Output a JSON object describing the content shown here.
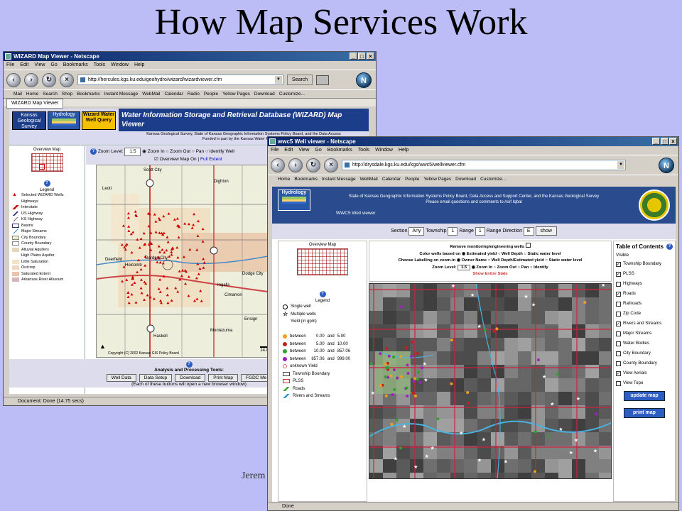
{
  "slide": {
    "title": "How Map Services Work",
    "footer": "Jerem"
  },
  "window1": {
    "title": "WIZARD Map Viewer - Netscape",
    "menu": [
      "File",
      "Edit",
      "View",
      "Go",
      "Bookmarks",
      "Tools",
      "Window",
      "Help"
    ],
    "url": "http://hercules.kgs.ku.edu/geohydro/wizard/wizardviewer.cfm",
    "search_label": "Search",
    "personal": [
      "Mail",
      "Home",
      "Search",
      "Shop",
      "Bookmarks",
      "Instant Message",
      "WebMail",
      "Calendar",
      "Radio",
      "People",
      "Yellow Pages",
      "Download",
      "Customize..."
    ],
    "tab": "WIZARD Map Viewer",
    "logo_kgs": "Kansas Geological Survey",
    "logo_hydro": "Hydrology",
    "logo_wizard": "Wizard Water Well Query",
    "page_title": "Water Information Storage and Retrieval Database (WIZARD) Map Viewer",
    "sub_line1": "Kansas Geological Survey, State of Kansas Geographic Information Systems Policy Board, and the Data Access",
    "sub_line2": "Funded in part by the Kansas Water Plan Fund.",
    "overview_label": "Overview Map",
    "legend_title": "Legend",
    "legend": [
      "Selected WIZARD Wells",
      "Highways",
      "Interstate",
      "US Highway",
      "KS Highway",
      "Basins",
      "Major Streams",
      "City Boundary",
      "County Boundary",
      "Alluvial Aquifers",
      "High Plains Aquifer",
      "Little Saturation",
      "Outcrop",
      "Saturated Extent",
      "Arkansas River Alluvium"
    ],
    "zoom_label": "Zoom Level:",
    "zoom_value": "1.5",
    "zoom_in": "Zoom In",
    "zoom_out": "Zoom Out",
    "pan": "Pan",
    "identify": "Identify Well",
    "overview_on": "Overview Map On",
    "full_extent": "Full Extent",
    "towns": [
      "Scott City",
      "Leoti",
      "Dighton",
      "Ness City",
      "Tribune",
      "Kearny",
      "Deerfield",
      "Holcomb",
      "Garden City",
      "Ingalls",
      "Cimarron",
      "Dodge City",
      "Ensign",
      "Montezuma",
      "Haskell",
      "Ulysses",
      "Sublette"
    ],
    "scale": "14.0 mi",
    "copyright": "Copyright (C) 2002 Kansas GIS Policy Board",
    "tools_title": "Analysis and Processing Tools:",
    "tools": [
      "Well Data",
      "Data Setup",
      "Download",
      "Print Map",
      "FGDC Me"
    ],
    "tools_note": "(Each of these buttons will open a new browser window)",
    "status": "Document: Done (14.75 secs)"
  },
  "window2": {
    "title": "wwc5 Well viewer - Netscape",
    "menu": [
      "File",
      "Edit",
      "View",
      "Go",
      "Bookmarks",
      "Tools",
      "Window",
      "Help"
    ],
    "url": "http://drysdale.kgs.ku.edu/kgs/wwc5/wellviewer.cfm",
    "personal": [
      "Home",
      "Bookmarks",
      "Instant Message",
      "WebMail",
      "Calendar",
      "People",
      "Yellow Pages",
      "Download",
      "Customize..."
    ],
    "logo_hydro": "Hydrology",
    "head_line1": "State of Kansas Geographic Information Systems Policy Board, Data Access and Support Center, and the Kansas Geological Survey",
    "head_line2": "Please email questions and comments to Asif Iqbal",
    "page_title": "WWC5 Well viewer",
    "section_label": "Section",
    "section_value": "Any",
    "township_label": "Township",
    "township_value": "1",
    "range_label": "Range",
    "range_value": "1",
    "range_dir_label": "Range Direction",
    "range_dir_value": "E",
    "show_label": "show",
    "overview_label": "Overview Map",
    "ctrl_remove": "Remove monitoring/engineering wells",
    "ctrl_color": "Color wells based on",
    "ctrl_color_opts": [
      "Estimated yield",
      "Well Depth",
      "Static water level"
    ],
    "ctrl_label": "Choose Labelling on zoom-in",
    "ctrl_label_opts": [
      "Owner Name",
      "Well Depth/Estimated yield",
      "Static water level"
    ],
    "ctrl_zoom": "Zoom Level:",
    "ctrl_zoom_value": "1.5",
    "ctrl_zoom_opts": [
      "Zoom In",
      "Zoom Out",
      "Pan",
      "Identify"
    ],
    "ctrl_show_state": "Show Entire State",
    "legend_title": "Legend",
    "legend": [
      "Single well",
      "Multiple wells",
      "Yield (in gpm)"
    ],
    "yield": [
      {
        "label": "between",
        "a": "0.00",
        "and": "and",
        "b": "5.00",
        "color": "#f0a020"
      },
      {
        "label": "between",
        "a": "5.00",
        "and": "and",
        "b": "10.00",
        "color": "#c02020"
      },
      {
        "label": "between",
        "a": "10.00",
        "and": "and",
        "b": "857.06",
        "color": "#30a030"
      },
      {
        "label": "between",
        "a": "857.06",
        "and": "and",
        "b": "999.00",
        "color": "#a020c0"
      }
    ],
    "unknown": "unknown Yield",
    "legend_layers": [
      "Township Boundary",
      "PLSS",
      "Roads",
      "Rivers and Streams"
    ],
    "toc_title": "Table of Contents",
    "toc_visible": "Visible",
    "toc": [
      {
        "label": "Township Boundary",
        "checked": true
      },
      {
        "label": "PLSS",
        "checked": true
      },
      {
        "label": "Highways",
        "checked": false
      },
      {
        "label": "Roads",
        "checked": true
      },
      {
        "label": "Railroads",
        "checked": false
      },
      {
        "label": "Zip Code",
        "checked": false
      },
      {
        "label": "Rivers and Streams",
        "checked": true
      },
      {
        "label": "Major Streams",
        "checked": false
      },
      {
        "label": "Water Bodies",
        "checked": false
      },
      {
        "label": "City Boundary",
        "checked": false
      },
      {
        "label": "County Boundary",
        "checked": false
      },
      {
        "label": "View Aerials",
        "checked": true
      },
      {
        "label": "View Topo",
        "checked": false
      }
    ],
    "update_btn": "update map",
    "print_btn": "print map",
    "status": "Done"
  }
}
